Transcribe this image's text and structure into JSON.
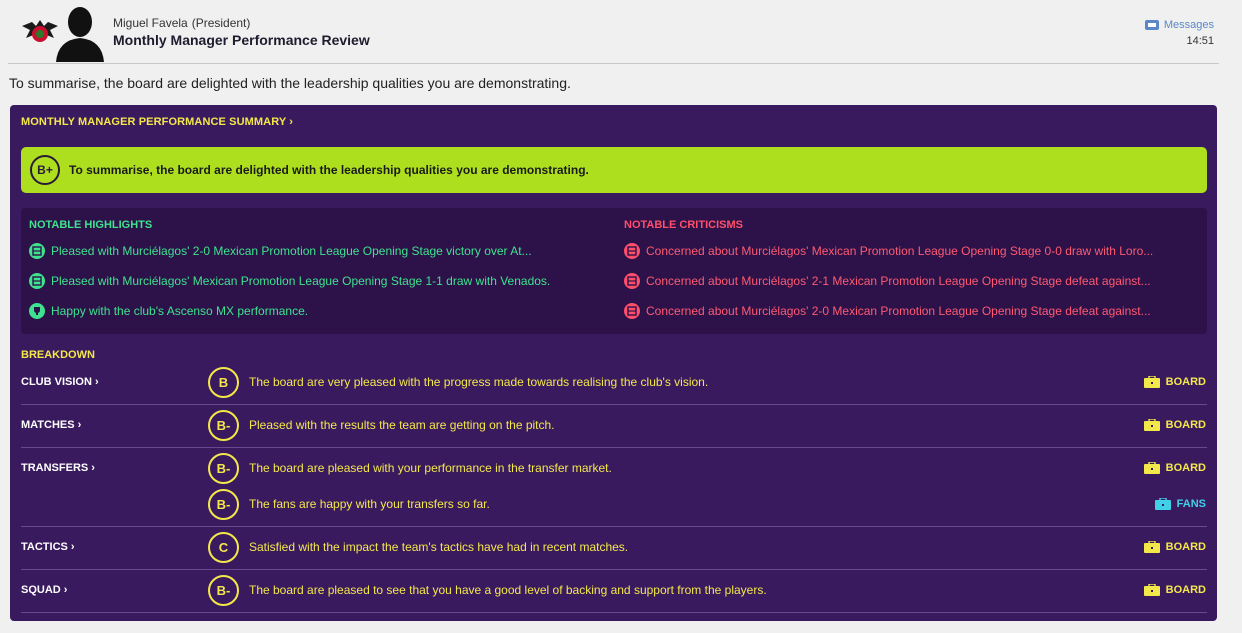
{
  "header": {
    "sender_name": "Miguel Favela",
    "sender_role": "(President)",
    "subject": "Monthly Manager Performance Review",
    "messages_label": "Messages",
    "time": "14:51"
  },
  "intro": "To summarise, the board are delighted with the leadership qualities you are demonstrating.",
  "panel": {
    "title": "MONTHLY MANAGER PERFORMANCE SUMMARY",
    "summary_grade": "B+",
    "summary_text": "To summarise, the board are delighted with the leadership qualities you are demonstrating.",
    "highlights_title": "NOTABLE HIGHLIGHTS",
    "highlights": [
      {
        "icon": "match-icon",
        "text": "Pleased with Murciélagos' 2-0 Mexican Promotion League Opening Stage victory over At..."
      },
      {
        "icon": "match-icon",
        "text": "Pleased with Murciélagos' Mexican Promotion League Opening Stage 1-1 draw with Venados."
      },
      {
        "icon": "trophy-icon",
        "text": "Happy with the club's Ascenso MX performance."
      }
    ],
    "criticisms_title": "NOTABLE CRITICISMS",
    "criticisms": [
      {
        "icon": "match-icon",
        "text": "Concerned about Murciélagos' Mexican Promotion League Opening Stage 0-0 draw with Loro..."
      },
      {
        "icon": "match-icon",
        "text": "Concerned about Murciélagos' 2-1 Mexican Promotion League Opening Stage defeat against..."
      },
      {
        "icon": "match-icon",
        "text": "Concerned about Murciélagos' 2-0 Mexican Promotion League Opening Stage defeat against..."
      }
    ],
    "breakdown_title": "BREAKDOWN",
    "breakdown": [
      {
        "label": "CLUB VISION",
        "grade": "B",
        "text": "The board are very pleased with the progress made towards realising the club's vision.",
        "tag": "BOARD"
      },
      {
        "label": "MATCHES",
        "grade": "B-",
        "text": "Pleased with the results the team are getting on the pitch.",
        "tag": "BOARD"
      },
      {
        "label": "TRANSFERS",
        "grade": "B-",
        "text": "The board are pleased with your performance in the transfer market.",
        "tag": "BOARD"
      },
      {
        "label": "",
        "grade": "B-",
        "text": "The fans are happy with your transfers so far.",
        "tag": "FANS"
      },
      {
        "label": "TACTICS",
        "grade": "C",
        "text": "Satisfied with the impact the team's tactics have had in recent matches.",
        "tag": "BOARD"
      },
      {
        "label": "SQUAD",
        "grade": "B-",
        "text": "The board are pleased to see that you have a good level of backing and support from the players.",
        "tag": "BOARD"
      }
    ]
  },
  "colors": {
    "panel_bg": "#3a1a5e",
    "accent_yellow": "#f3e84a",
    "summary_green": "#aedf1e",
    "highlight_green": "#3ee28f",
    "criticism_red": "#ff4f6a",
    "fans_cyan": "#40d0e8"
  }
}
